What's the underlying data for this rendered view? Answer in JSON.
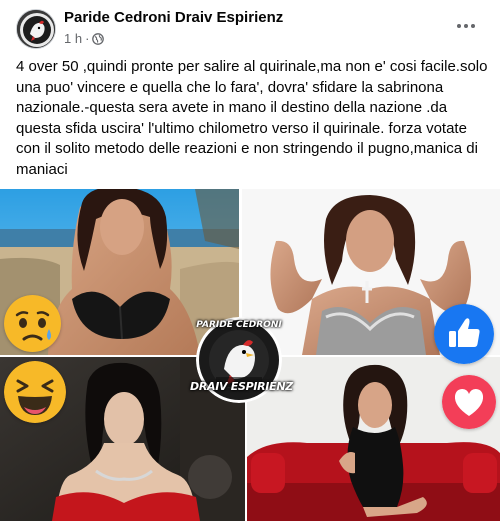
{
  "post": {
    "author": "Paride Cedroni Draiv Espirienz",
    "time": "1 h",
    "separator": "·",
    "visibility_icon": "globe-icon",
    "more_icon": "more-options-icon",
    "more_label": "•••",
    "text": "4 over 50 ,quindi pronte per salire al quirinale,ma non e' cosi facile.solo una puo' vincere e quella che lo fara', dovra' sfidare la sabrinona nazionale.-questa sera avete in mano il destino della nazione .da questa sfida uscira' l'ultimo chilometro verso il quirinale. forza votate con il solito metodo delle reazioni e non stringendo il pugno,manica di maniaci"
  },
  "collage": {
    "photos": [
      "photo-top-left",
      "photo-top-right",
      "photo-bottom-left",
      "photo-bottom-right"
    ],
    "reactions": {
      "top_left": "sad-reaction-icon",
      "top_right": "like-reaction-icon",
      "bottom_left": "haha-reaction-icon",
      "bottom_right": "love-reaction-icon"
    },
    "logo": {
      "top_text": "PARIDE CEDRONI",
      "bottom_text": "DRAIV ESPIRIENZ"
    }
  },
  "colors": {
    "author_text": "#050505",
    "meta_text": "#65676b",
    "like_blue": "#1877f2",
    "love_red": "#f33e58",
    "reaction_yellow": "#f7b928"
  }
}
